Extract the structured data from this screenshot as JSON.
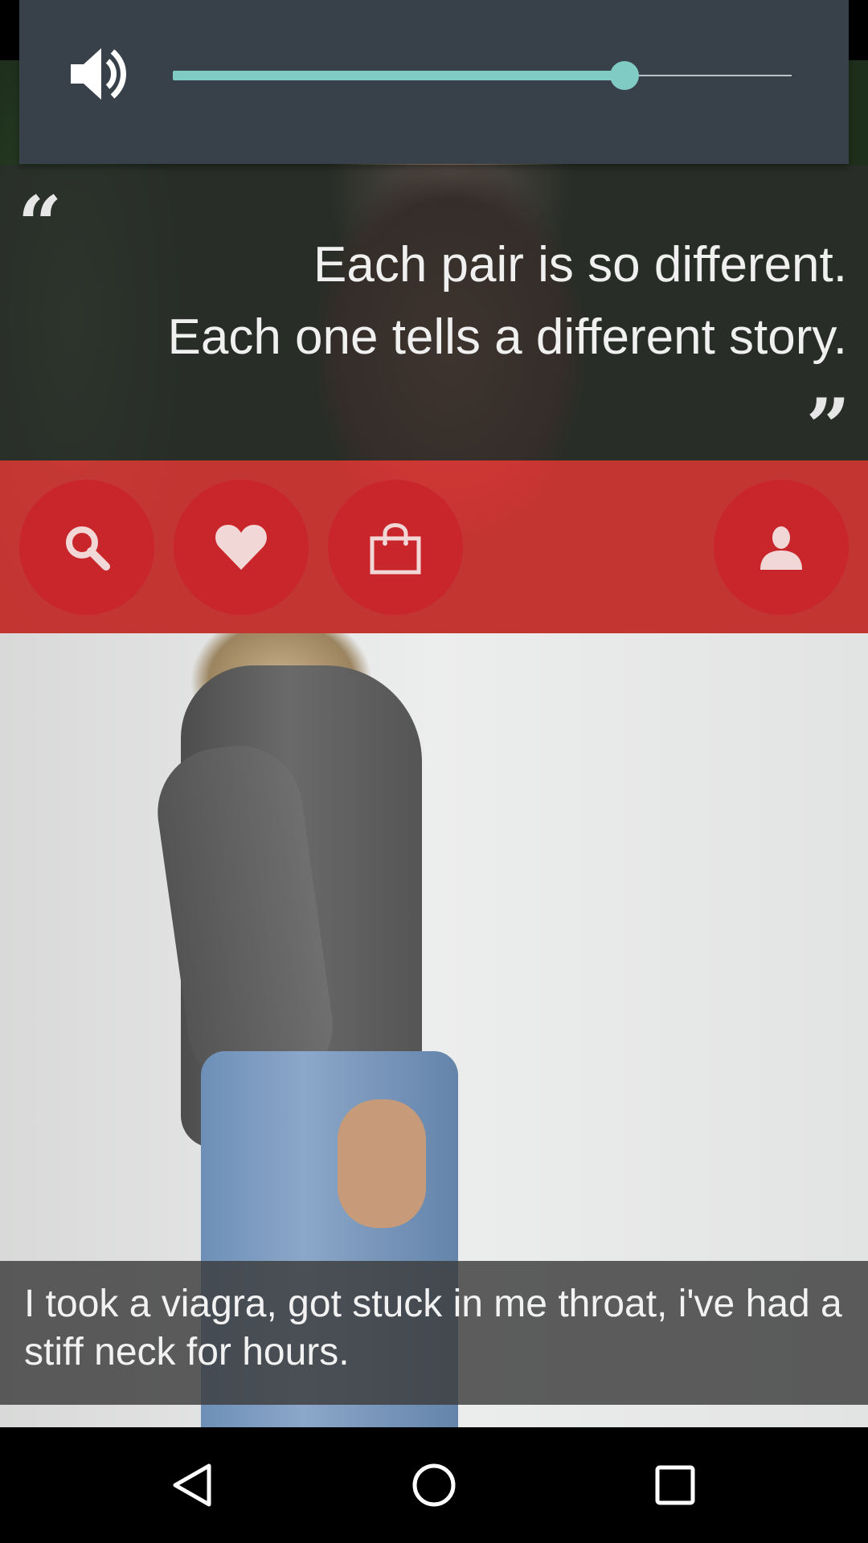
{
  "quote": {
    "line1": "Each pair is so different.",
    "line2": "Each one tells a different story.",
    "open_mark": "“",
    "close_mark": "”"
  },
  "actions": [
    {
      "name": "search",
      "icon": "search-icon"
    },
    {
      "name": "favorites",
      "icon": "heart-icon"
    },
    {
      "name": "shop",
      "icon": "shopping-bag-icon"
    },
    {
      "name": "profile",
      "icon": "user-icon"
    }
  ],
  "caption": {
    "text": "I took a viagra, got stuck in me throat, i've had a stiff neck for hours."
  },
  "volume": {
    "icon": "speaker-icon",
    "level": 0.73,
    "accent_color": "#80cbc4",
    "panel_color": "#384049"
  },
  "nav": {
    "back_icon": "back-triangle-icon",
    "home_icon": "home-circle-icon",
    "recents_icon": "recents-square-icon"
  },
  "colors": {
    "action_band": "#e83737",
    "action_button": "#c9262c"
  }
}
